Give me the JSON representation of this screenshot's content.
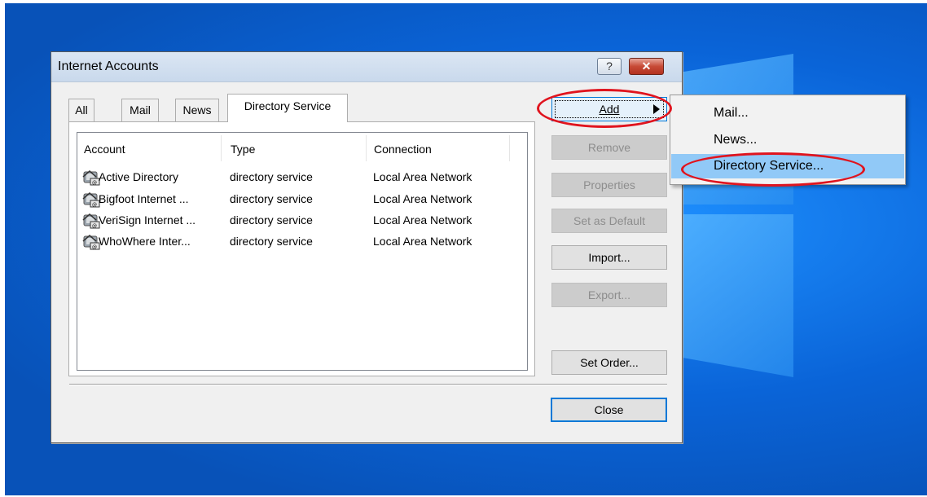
{
  "window": {
    "title": "Internet Accounts",
    "help_label": "?",
    "close_x_label": "✕"
  },
  "tabs": [
    {
      "label": "All"
    },
    {
      "label": "Mail"
    },
    {
      "label": "News"
    },
    {
      "label": "Directory Service",
      "selected": true
    }
  ],
  "list": {
    "columns": [
      "Account",
      "Type",
      "Connection"
    ],
    "rows": [
      {
        "account": "Active Directory",
        "type": "directory service",
        "connection": "Local Area Network"
      },
      {
        "account": "Bigfoot Internet ...",
        "type": "directory service",
        "connection": "Local Area Network"
      },
      {
        "account": "VeriSign Internet ...",
        "type": "directory service",
        "connection": "Local Area Network"
      },
      {
        "account": "WhoWhere Inter...",
        "type": "directory service",
        "connection": "Local Area Network"
      }
    ],
    "row_icon": "address-book-icon"
  },
  "buttons": {
    "add": "Add",
    "remove": "Remove",
    "properties": "Properties",
    "set_default": "Set as Default",
    "import": "Import...",
    "export": "Export...",
    "set_order": "Set Order...",
    "close": "Close"
  },
  "add_menu": {
    "items": [
      "Mail...",
      "News...",
      "Directory Service..."
    ],
    "highlighted": "Directory Service..."
  },
  "colors": {
    "desktop": "#0a64d8",
    "highlight": "#91c9f7",
    "annotation": "#e0141e",
    "accent": "#0078d7"
  }
}
